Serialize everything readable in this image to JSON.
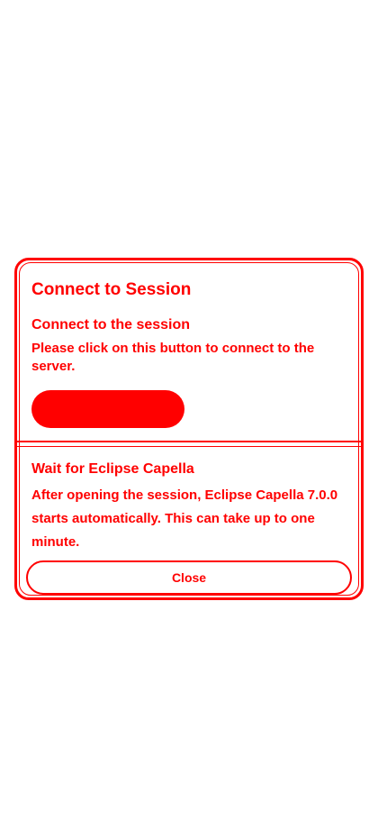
{
  "dialog": {
    "title": "Connect to Session",
    "connect_section": {
      "heading": "Connect to the session",
      "description": "Please click on this button to connect to the server.",
      "button_label": ""
    },
    "wait_section": {
      "heading": "Wait for Eclipse Capella",
      "description": "After opening the session, Eclipse Capella 7.0.0 starts automatically. This can take up to one minute."
    },
    "close_label": "Close"
  },
  "colors": {
    "accent": "#ff0000",
    "background": "#ffffff"
  }
}
